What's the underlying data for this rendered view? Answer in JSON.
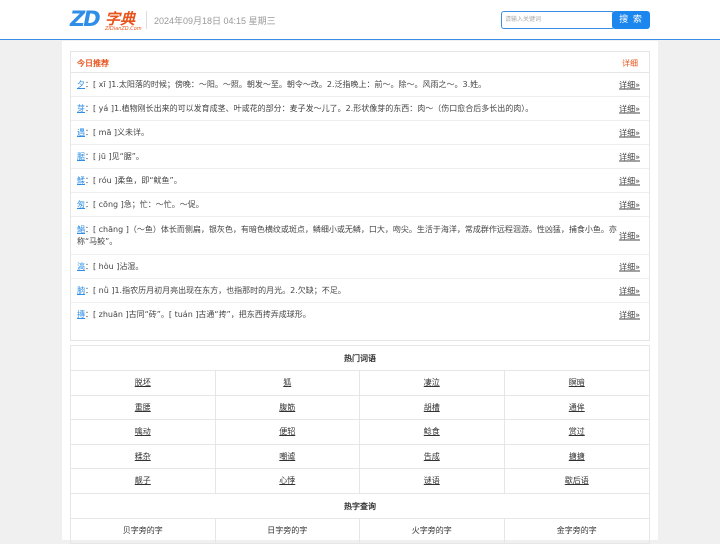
{
  "header": {
    "logo_zd": "ZD",
    "logo_cn": "字典",
    "logo_sub": "ZIDianZD.Com",
    "date": "2024年09月18日 04:15 星期三",
    "search_placeholder": "请输入关键词",
    "search_button": "搜 索"
  },
  "recommend": {
    "title": "今日推荐",
    "more": "详细",
    "items": [
      {
        "char": "夕",
        "text": "：[ xī ]1.太阳落的时候；傍晚：～阳。～照。朝发～至。朝令～改。2.泛指晚上：前～。除～。风雨之～。3.姓。",
        "link": "详细»"
      },
      {
        "char": "芽",
        "text": "：[ yá ]1.植物刚长出来的可以发育成茎、叶或花的部分：麦子发～儿了。2.形状像芽的东西：肉～（伤口愈合后多长出的肉）。",
        "link": "详细»"
      },
      {
        "char": "遇",
        "text": "：[ mā ]义未详。",
        "link": "详细»"
      },
      {
        "char": "腒",
        "text": "：[ jū ]见“腒”。",
        "link": "详细»"
      },
      {
        "char": "鰇",
        "text": "：[ róu ]柔鱼，即“鱿鱼”。",
        "link": "详细»"
      },
      {
        "char": "匆",
        "text": "：[ cōng ]急；忙：～忙。～促。",
        "link": "详细»"
      },
      {
        "char": "鯧",
        "text": "：[ chāng ]（～鱼）体长而侧扁，银灰色，有暗色横纹或斑点，鳞细小或无鳞，口大，吻尖。生活于海洋，常成群作远程洄游。性凶猛，捕食小鱼。亦称“马鲛”。",
        "link": "详细»"
      },
      {
        "char": "滈",
        "text": "：[ hòu ]沾湿。",
        "link": "详细»"
      },
      {
        "char": "朒",
        "text": "：[ nǜ ]1.指农历月初月亮出现在东方，也指那时的月光。2.欠缺；不足。",
        "link": "详细»"
      },
      {
        "char": "摶",
        "text": "：[ zhuān ]古同“砖”。[ tuán ]古通“抟”，把东西抟弄成球形。",
        "link": "详细»"
      }
    ]
  },
  "hot_words": {
    "title": "热门词语",
    "words": [
      "脱坯",
      "狐",
      "凄泣",
      "瞑暗",
      "重腰",
      "腹筋",
      "胡槽",
      "通侔",
      "噙动",
      "便轺",
      "鲶食",
      "赏过",
      "糅杂",
      "嘲谑",
      "告成",
      "搪搪",
      "靓子",
      "心悸",
      "谜语",
      "歇后语"
    ]
  },
  "hot_query": {
    "title": "热字查询",
    "items": [
      "贝字旁的字",
      "日字旁的字",
      "火字旁的字",
      "金字旁的字"
    ]
  }
}
